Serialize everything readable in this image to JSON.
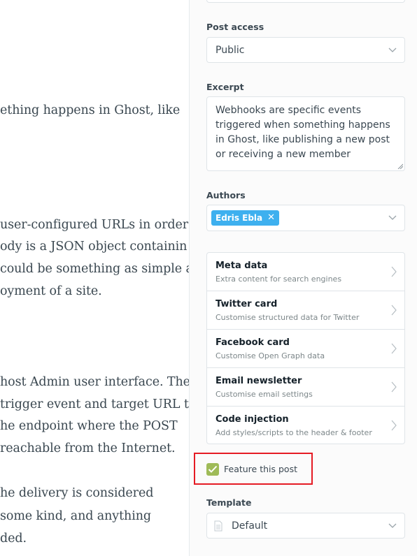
{
  "editor": {
    "lines": [
      "ething happens in Ghost, like",
      "user-configured URLs in order",
      "ody is a JSON object containin",
      "could be something as simple a",
      "oyment of a site.",
      "host Admin user interface. The",
      "trigger event and target URL to",
      "he endpoint where the POST",
      "reachable from the Internet.",
      "he delivery is considered",
      " some kind, and anything",
      "ded."
    ]
  },
  "sidebar": {
    "post_access": {
      "label": "Post access",
      "value": "Public",
      "icon": "chevron-down-icon"
    },
    "excerpt": {
      "label": "Excerpt",
      "value": "Webhooks are specific events triggered when something happens in Ghost, like publishing a new post or receiving a new member"
    },
    "authors": {
      "label": "Authors",
      "tags": [
        {
          "name": "Edris Ebla",
          "remove": "✕"
        }
      ],
      "icon": "chevron-down-icon"
    },
    "menu": [
      {
        "title": "Meta data",
        "subtitle": "Extra content for search engines"
      },
      {
        "title": "Twitter card",
        "subtitle": "Customise structured data for Twitter"
      },
      {
        "title": "Facebook card",
        "subtitle": "Customise Open Graph data"
      },
      {
        "title": "Email newsletter",
        "subtitle": "Customise email settings"
      },
      {
        "title": "Code injection",
        "subtitle": "Add styles/scripts to the header & footer"
      }
    ],
    "feature": {
      "label": "Feature this post",
      "checked": true
    },
    "template": {
      "label": "Template",
      "value": "Default",
      "icon": "document-icon"
    }
  },
  "colors": {
    "accent": "#3eb0ef",
    "checkbox": "#9fbb58",
    "highlight": "#e51b24"
  }
}
